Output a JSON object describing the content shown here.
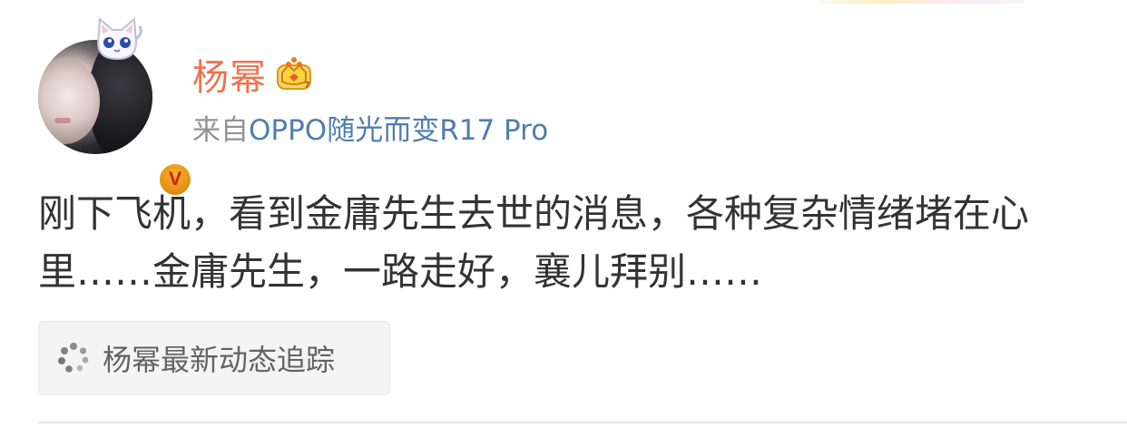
{
  "post": {
    "author": {
      "name": "杨幂",
      "verified_badge": "V",
      "avatar_icon": "avatar-photo",
      "member_icon": "crown-icon",
      "pendant_icon": "cat-pendant-icon"
    },
    "source": {
      "prefix": "来自",
      "device": "OPPO随光而变R17 Pro"
    },
    "text": "刚下飞机，看到金庸先生去世的消息，各种复杂情绪堵在心里……金庸先生，一路走好，襄儿拜别……",
    "topic_chip": {
      "icon": "loading-dots-icon",
      "label": "杨幂最新动态追踪"
    }
  },
  "colors": {
    "username": "#eb7350",
    "source_link": "#507daf",
    "source_prefix": "#939393",
    "body_text": "#333333",
    "chip_background": "#f4f4f4",
    "chip_text": "#636363",
    "verified_badge": "#e89216"
  }
}
